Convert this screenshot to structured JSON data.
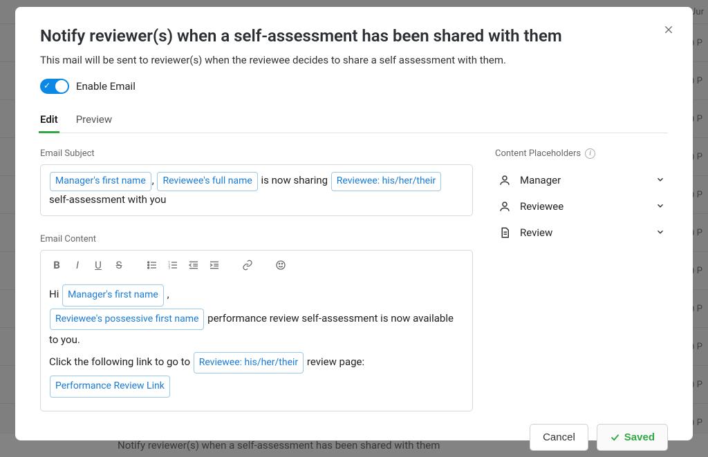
{
  "background": {
    "header_right": "Jur",
    "row_badge_prefix": "P",
    "bottom_text": "Notify reviewer(s) when a self-assessment has been shared with them"
  },
  "modal": {
    "title": "Notify reviewer(s) when a self-assessment has been shared with them",
    "subtitle": "This mail will be sent to reviewer(s) when the reviewee decides to share a self assessment with them.",
    "toggle_label": "Enable Email",
    "tabs": {
      "edit": "Edit",
      "preview": "Preview"
    },
    "subject_label": "Email Subject",
    "subject": {
      "chip1": "Manager's first name",
      "sep1": ",",
      "chip2": "Reviewee's full name",
      "mid": " is now sharing ",
      "chip3": "Reviewee: his/her/their",
      "tail": " self-assessment with you"
    },
    "content_label": "Email Content",
    "content": {
      "line1_pre": "Hi ",
      "line1_chip": "Manager's first name",
      "line1_post": " ,",
      "line2_chip": "Reviewee's possessive first name",
      "line2_post": " performance review self-assessment is now available to you.",
      "line3_pre": "Click the following link to go to ",
      "line3_chip": "Reviewee: his/her/their",
      "line3_post": " review page:",
      "line4_chip": "Performance Review Link"
    },
    "placeholders": {
      "header": "Content Placeholders",
      "items": [
        {
          "label": "Manager"
        },
        {
          "label": "Reviewee"
        },
        {
          "label": "Review"
        }
      ]
    },
    "footer": {
      "cancel": "Cancel",
      "saved": "Saved"
    }
  }
}
